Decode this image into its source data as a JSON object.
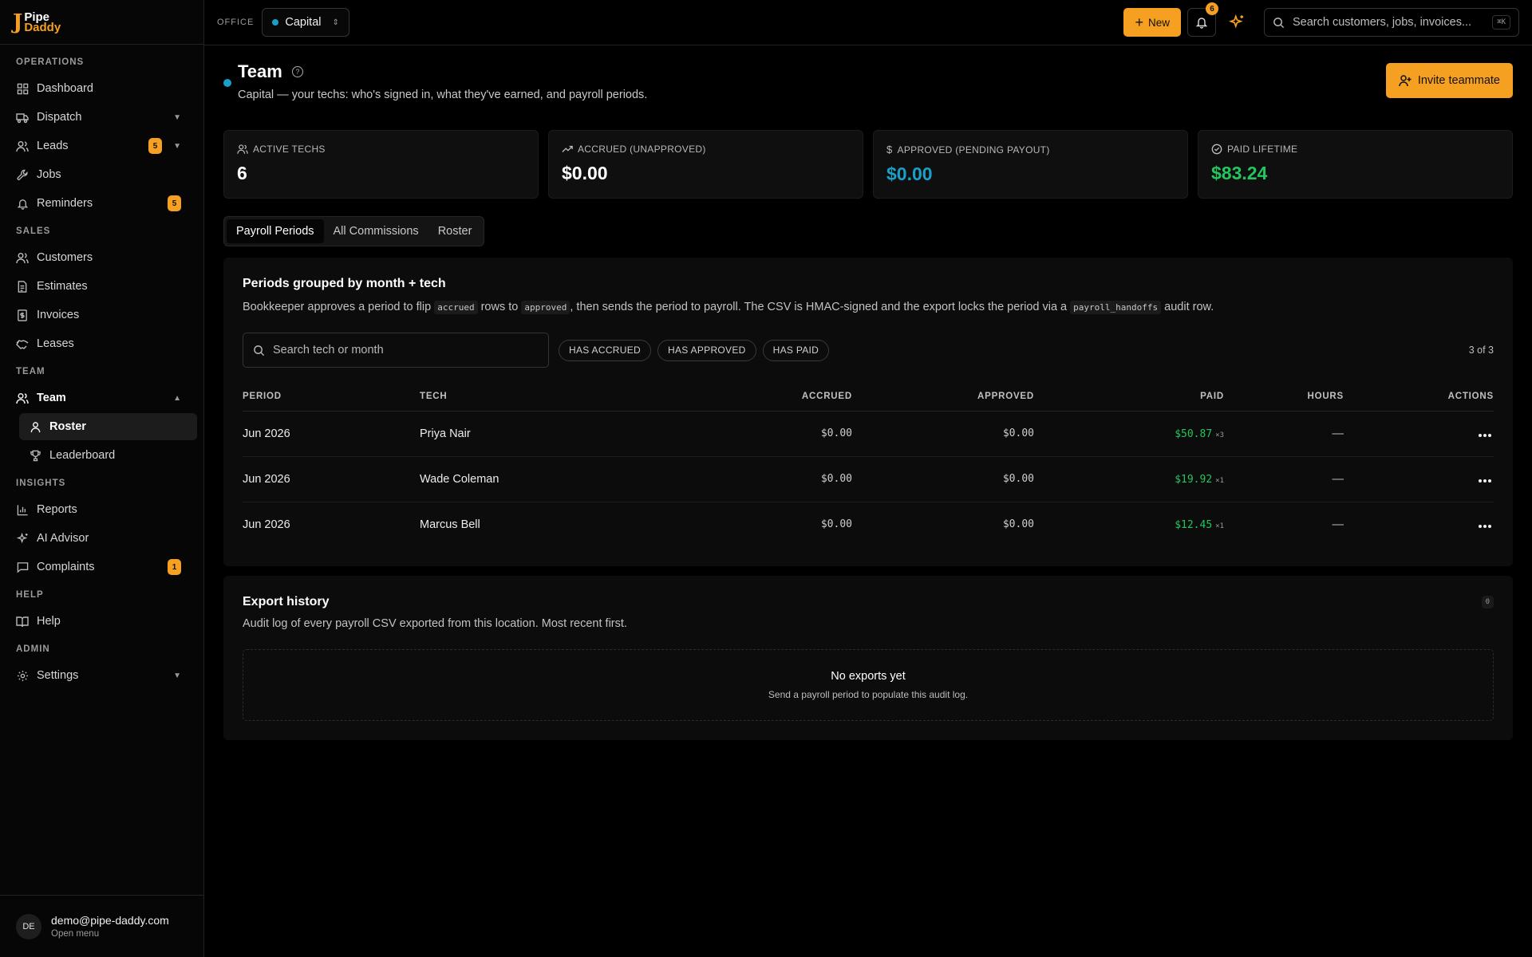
{
  "brand": {
    "line1": "Pipe",
    "line2": "Daddy",
    "mark": "J"
  },
  "sidebar": {
    "sections": [
      {
        "label": "OPERATIONS"
      },
      {
        "label": "SALES"
      },
      {
        "label": "TEAM"
      },
      {
        "label": "INSIGHTS"
      },
      {
        "label": "HELP"
      },
      {
        "label": "ADMIN"
      }
    ],
    "items": {
      "dashboard": "Dashboard",
      "dispatch": "Dispatch",
      "leads": "Leads",
      "leads_badge": "5",
      "jobs": "Jobs",
      "reminders": "Reminders",
      "reminders_badge": "5",
      "customers": "Customers",
      "estimates": "Estimates",
      "invoices": "Invoices",
      "leases": "Leases",
      "team": "Team",
      "roster": "Roster",
      "leaderboard": "Leaderboard",
      "reports": "Reports",
      "ai_advisor": "AI Advisor",
      "complaints": "Complaints",
      "complaints_badge": "1",
      "help": "Help",
      "settings": "Settings"
    },
    "user": {
      "initials": "DE",
      "email": "demo@pipe-daddy.com",
      "sub": "Open menu"
    }
  },
  "topbar": {
    "office_label": "OFFICE",
    "office_value": "Capital",
    "new_label": "New",
    "notif_count": "6",
    "search_placeholder": "Search customers, jobs, invoices...",
    "search_kbd": "⌘K"
  },
  "page": {
    "title": "Team",
    "subtitle": "Capital — your techs: who's signed in, what they've earned, and payroll periods.",
    "invite_label": "Invite teammate"
  },
  "stats": [
    {
      "label": "ACTIVE TECHS",
      "value": "6"
    },
    {
      "label": "ACCRUED (UNAPPROVED)",
      "value": "$0.00"
    },
    {
      "label": "APPROVED (PENDING PAYOUT)",
      "value": "$0.00"
    },
    {
      "label": "PAID LIFETIME",
      "value": "$83.24"
    }
  ],
  "tabs": [
    "Payroll Periods",
    "All Commissions",
    "Roster"
  ],
  "periods": {
    "title": "Periods grouped by month + tech",
    "desc": {
      "p1": "Bookkeeper approves a period to flip ",
      "c1": "accrued",
      "p2": " rows to ",
      "c2": "approved",
      "p3": ", then sends the period to payroll. The CSV is HMAC-signed and the export locks the period via a ",
      "c3": "payroll_handoffs",
      "p4": " audit row."
    },
    "search_placeholder": "Search tech or month",
    "chips": [
      "HAS ACCRUED",
      "HAS APPROVED",
      "HAS PAID"
    ],
    "count": "3 of 3",
    "columns": [
      "PERIOD",
      "TECH",
      "ACCRUED",
      "APPROVED",
      "PAID",
      "HOURS",
      "ACTIONS"
    ],
    "rows": [
      {
        "period": "Jun 2026",
        "tech": "Priya Nair",
        "accrued": "$0.00",
        "approved": "$0.00",
        "paid": "$50.87",
        "paid_n": "×3",
        "hours": "—"
      },
      {
        "period": "Jun 2026",
        "tech": "Wade Coleman",
        "accrued": "$0.00",
        "approved": "$0.00",
        "paid": "$19.92",
        "paid_n": "×1",
        "hours": "—"
      },
      {
        "period": "Jun 2026",
        "tech": "Marcus Bell",
        "accrued": "$0.00",
        "approved": "$0.00",
        "paid": "$12.45",
        "paid_n": "×1",
        "hours": "—"
      }
    ]
  },
  "export": {
    "title": "Export history",
    "desc": "Audit log of every payroll CSV exported from this location. Most recent first.",
    "count": "0",
    "empty_title": "No exports yet",
    "empty_sub": "Send a payroll period to populate this audit log."
  },
  "colors": {
    "accent": "#f5a021",
    "blue": "#1aa0c8",
    "green": "#22c55e"
  }
}
